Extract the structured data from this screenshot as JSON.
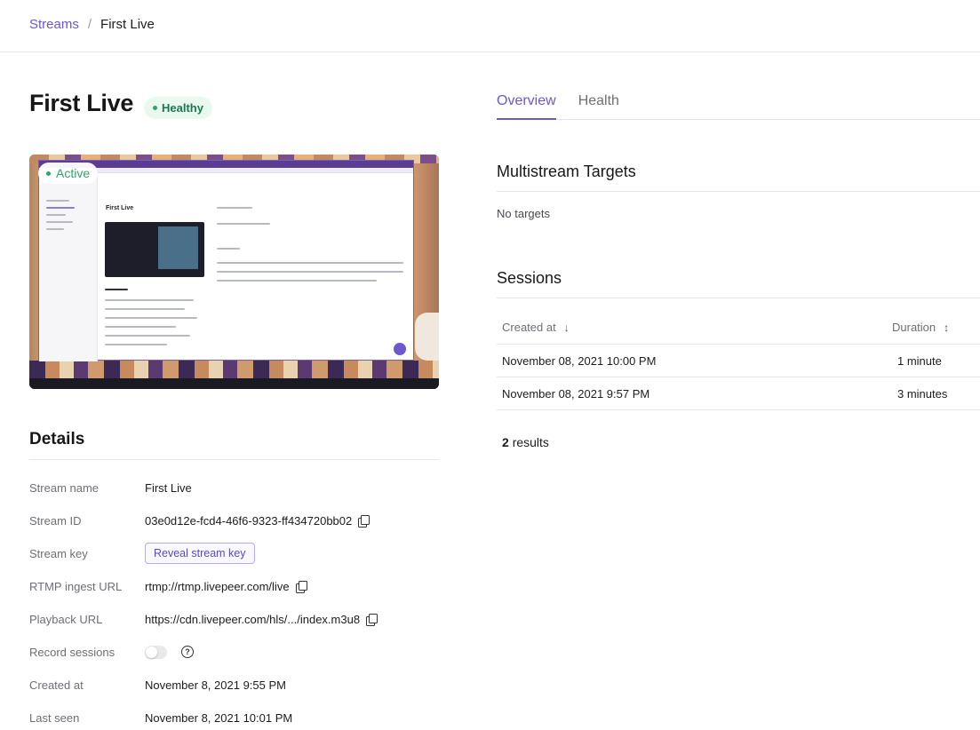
{
  "breadcrumb": {
    "parent": "Streams",
    "separator": "/",
    "current": "First Live"
  },
  "stream": {
    "title": "First Live",
    "health_badge": "Healthy"
  },
  "preview": {
    "status": "Active",
    "mini_title": "First Live"
  },
  "details": {
    "title": "Details",
    "rows": [
      {
        "label": "Stream name",
        "value": "First Live"
      },
      {
        "label": "Stream ID",
        "value": "03e0d12e-fcd4-46f6-9323-ff434720bb02"
      },
      {
        "label": "Stream key",
        "value": "Reveal stream key"
      },
      {
        "label": "RTMP ingest URL",
        "value": "rtmp://rtmp.livepeer.com/live"
      },
      {
        "label": "Playback URL",
        "value": "https://cdn.livepeer.com/hls/.../index.m3u8"
      },
      {
        "label": "Record sessions",
        "value": ""
      },
      {
        "label": "Created at",
        "value": "November 8, 2021 9:55 PM"
      },
      {
        "label": "Last seen",
        "value": "November 8, 2021 10:01 PM"
      }
    ],
    "record_sessions_enabled": false
  },
  "tabs": [
    {
      "label": "Overview",
      "active": true
    },
    {
      "label": "Health",
      "active": false
    }
  ],
  "multistream": {
    "title": "Multistream Targets",
    "empty_text": "No targets"
  },
  "sessions": {
    "title": "Sessions",
    "columns": [
      {
        "label": "Created at",
        "sort": "↓"
      },
      {
        "label": "Duration",
        "sort": "↕"
      }
    ],
    "rows": [
      {
        "created_at": "November 08, 2021 10:00 PM",
        "duration": "1 minute"
      },
      {
        "created_at": "November 08, 2021 9:57 PM",
        "duration": "3 minutes"
      }
    ],
    "result_count": "2",
    "result_suffix": "results"
  },
  "colors": {
    "accent": "#6e56cf",
    "success": "#30a46c",
    "badge_bg": "#e9f9ee"
  }
}
